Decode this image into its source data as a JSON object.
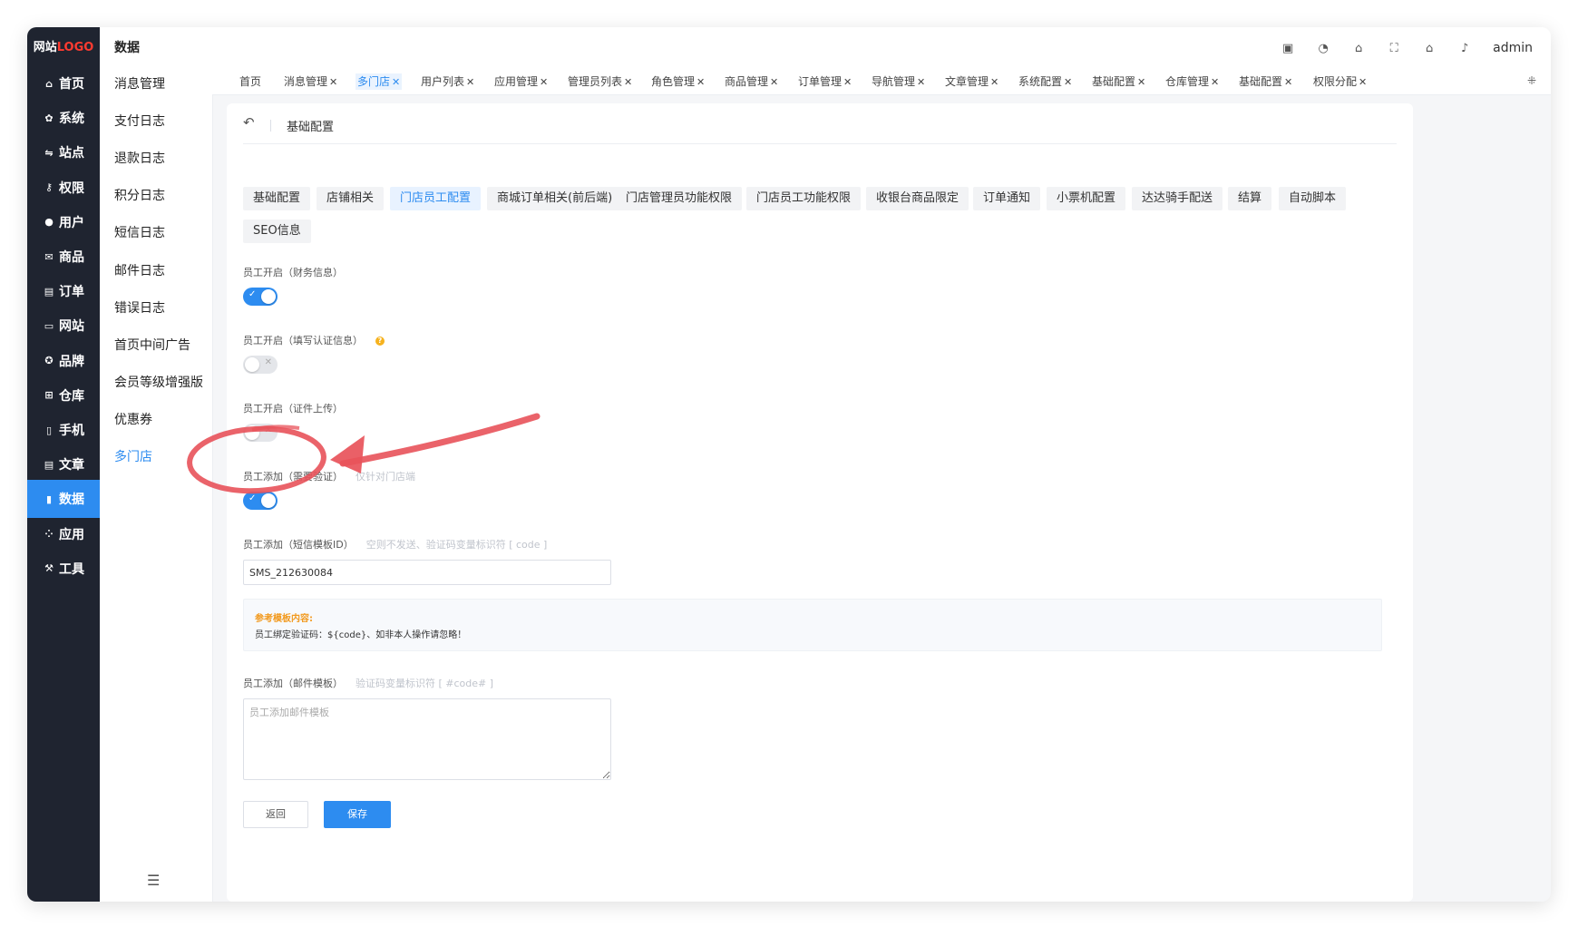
{
  "logo": {
    "part1": "网站",
    "part2": "LOGO"
  },
  "rail": [
    {
      "label": "首页",
      "icon": "home-icon",
      "glyph": "⌂"
    },
    {
      "label": "系统",
      "icon": "gear-icon",
      "glyph": "✿"
    },
    {
      "label": "站点",
      "icon": "site-icon",
      "glyph": "⇋"
    },
    {
      "label": "权限",
      "icon": "permission-icon",
      "glyph": "⚷"
    },
    {
      "label": "用户",
      "icon": "user-icon",
      "glyph": "●"
    },
    {
      "label": "商品",
      "icon": "goods-icon",
      "glyph": "✉"
    },
    {
      "label": "订单",
      "icon": "order-icon",
      "glyph": "▤"
    },
    {
      "label": "网站",
      "icon": "website-icon",
      "glyph": "▭"
    },
    {
      "label": "品牌",
      "icon": "brand-icon",
      "glyph": "✪"
    },
    {
      "label": "仓库",
      "icon": "warehouse-icon",
      "glyph": "⊞"
    },
    {
      "label": "手机",
      "icon": "phone-icon",
      "glyph": "▯"
    },
    {
      "label": "文章",
      "icon": "article-icon",
      "glyph": "▤"
    },
    {
      "label": "数据",
      "icon": "chart-icon",
      "glyph": "▮"
    },
    {
      "label": "应用",
      "icon": "apps-icon",
      "glyph": "⁘"
    },
    {
      "label": "工具",
      "icon": "wrench-icon",
      "glyph": "⚒"
    }
  ],
  "rail_active_index": 12,
  "submenu": {
    "title": "数据",
    "items": [
      "消息管理",
      "支付日志",
      "退款日志",
      "积分日志",
      "短信日志",
      "邮件日志",
      "错误日志",
      "首页中间广告",
      "会员等级增强版",
      "优惠券",
      "多门店"
    ],
    "active_index": 10
  },
  "header": {
    "icons": [
      "translate-icon",
      "palette-icon",
      "store-icon",
      "fullscreen-icon",
      "home-icon",
      "bell-icon"
    ],
    "icon_glyphs": [
      "▣",
      "◔",
      "⌂",
      "⛶",
      "⌂",
      "♪"
    ],
    "user": "admin"
  },
  "tabs": [
    {
      "label": "首页",
      "closable": false
    },
    {
      "label": "消息管理",
      "closable": true
    },
    {
      "label": "多门店",
      "closable": true
    },
    {
      "label": "用户列表",
      "closable": true
    },
    {
      "label": "应用管理",
      "closable": true
    },
    {
      "label": "管理员列表",
      "closable": true
    },
    {
      "label": "角色管理",
      "closable": true
    },
    {
      "label": "商品管理",
      "closable": true
    },
    {
      "label": "订单管理",
      "closable": true
    },
    {
      "label": "导航管理",
      "closable": true
    },
    {
      "label": "文章管理",
      "closable": true
    },
    {
      "label": "系统配置",
      "closable": true
    },
    {
      "label": "基础配置",
      "closable": true
    },
    {
      "label": "仓库管理",
      "closable": true
    },
    {
      "label": "基础配置",
      "closable": true
    },
    {
      "label": "权限分配",
      "closable": true
    }
  ],
  "tabs_active_index": 2,
  "page": {
    "back_title": "基础配置"
  },
  "config_tabs": [
    "基础配置",
    "店铺相关",
    "门店员工配置",
    "商城订单相关(前后端)",
    "门店管理员功能权限",
    "门店员工功能权限",
    "收银台商品限定",
    "订单通知",
    "小票机配置",
    "达达骑手配送",
    "结算",
    "自动脚本",
    "SEO信息"
  ],
  "config_tabs_active_index": 2,
  "fields": {
    "finance": {
      "label": "员工开启（财务信息）",
      "on": true
    },
    "auth": {
      "label": "员工开启（填写认证信息）",
      "on": false
    },
    "cert": {
      "label": "员工开启（证件上传）",
      "on": false
    },
    "verify": {
      "label": "员工添加（需要验证）",
      "hint": "仅针对门店端",
      "on": true
    },
    "sms": {
      "label": "员工添加（短信模板ID）",
      "hint": "空则不发送、验证码变量标识符 [ code ]",
      "value": "SMS_212630084"
    },
    "reference": {
      "title": "参考模板内容:",
      "body": "员工绑定验证码：${code}、如非本人操作请忽略！"
    },
    "email": {
      "label": "员工添加（邮件模板）",
      "hint": "验证码变量标识符 [ #code# ]",
      "placeholder": "员工添加邮件模板"
    }
  },
  "buttons": {
    "back": "返回",
    "save": "保存"
  },
  "colors": {
    "primary": "#2d8cf0",
    "sidebar": "#1f2430",
    "annotation": "#e8525a",
    "warning": "#f29a1f"
  }
}
